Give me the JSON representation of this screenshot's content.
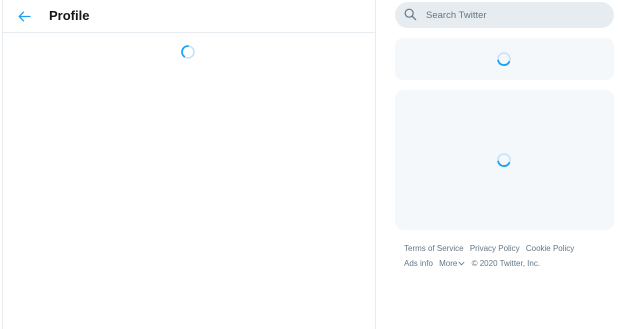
{
  "header": {
    "title": "Profile"
  },
  "search": {
    "placeholder": "Search Twitter"
  },
  "footer": {
    "terms": "Terms of Service",
    "privacy": "Privacy Policy",
    "cookie": "Cookie Policy",
    "ads": "Ads info",
    "more": "More",
    "copyright": "© 2020 Twitter, Inc."
  },
  "icons": {
    "back": "arrow-left-icon",
    "search": "search-icon",
    "spinner": "loading-spinner-icon",
    "more": "chevron-down-icon"
  },
  "colors": {
    "accent": "#1da1f2",
    "border": "#e6ecf0",
    "panel": "#f5f8fa",
    "muted_text": "#657786",
    "search_bg": "#e6ecf0"
  }
}
